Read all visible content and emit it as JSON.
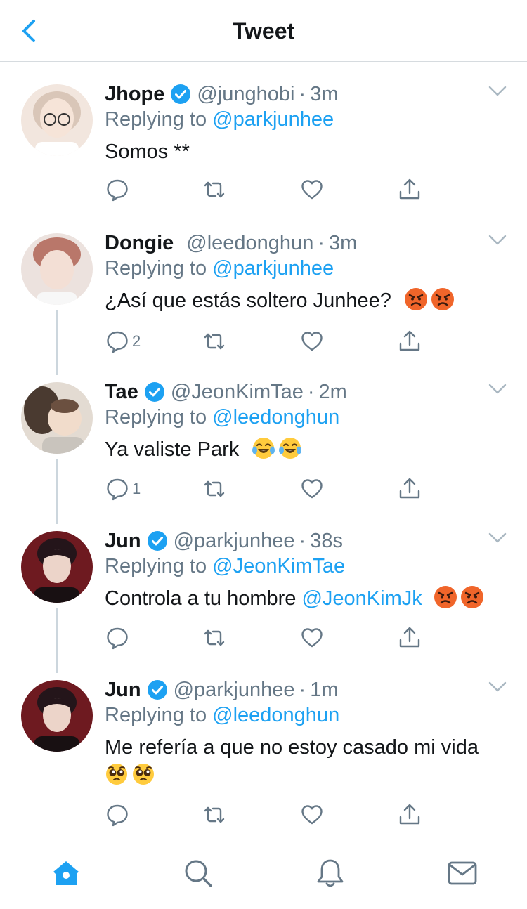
{
  "header": {
    "title": "Tweet"
  },
  "tweets": [
    {
      "name": "Jhope",
      "verified": true,
      "handle": "@junghobi",
      "time": "3m",
      "replying_prefix": "Replying to ",
      "replying_to": "@parkjunhee",
      "text": "Somos **",
      "reply_count": "",
      "avatar_colors": [
        "#f3e3d8",
        "#e2cfc2"
      ]
    },
    {
      "name": "Dongie",
      "verified": false,
      "handle": "@leedonghun",
      "time": "3m",
      "replying_prefix": "Replying to ",
      "replying_to": "@parkjunhee",
      "text": "¿Así que estás soltero Junhee?",
      "text_emoji": [
        "angry-face",
        "angry-face"
      ],
      "reply_count": "2",
      "avatar_colors": [
        "#e8dcd6",
        "#c9a79a"
      ]
    },
    {
      "name": "Tae",
      "verified": true,
      "handle": "@JeonKimTae",
      "time": "2m",
      "replying_prefix": "Replying to ",
      "replying_to": "@leedonghun",
      "text": "Ya valiste Park",
      "text_emoji": [
        "tears-of-joy-face",
        "tears-of-joy-face"
      ],
      "reply_count": "1",
      "avatar_colors": [
        "#d9cfc4",
        "#8c6b52"
      ]
    },
    {
      "name": "Jun",
      "verified": true,
      "handle": "@parkjunhee",
      "time": "38s",
      "replying_prefix": "Replying to ",
      "replying_to": "@JeonKimTae",
      "text": "Controla a tu hombre ",
      "text_mention": "@JeonKimJk",
      "text_emoji": [
        "angry-face",
        "angry-face"
      ],
      "reply_count": "",
      "avatar_colors": [
        "#7a1f24",
        "#2b1114"
      ]
    },
    {
      "name": "Jun",
      "verified": true,
      "handle": "@parkjunhee",
      "time": "1m",
      "replying_prefix": "Replying to ",
      "replying_to": "@leedonghun",
      "text": "Me refería a que no estoy casado mi vida",
      "text_emoji": [
        "pleading-face",
        "pleading-face"
      ],
      "reply_count": "",
      "avatar_colors": [
        "#7a1f24",
        "#2b1114"
      ]
    }
  ],
  "tabbar": {
    "items": [
      "home-icon",
      "search-icon",
      "notifications-icon",
      "messages-icon"
    ]
  },
  "colors": {
    "accent": "#1da1f2",
    "secondary_text": "#657786",
    "divider": "#d6dbdf"
  }
}
